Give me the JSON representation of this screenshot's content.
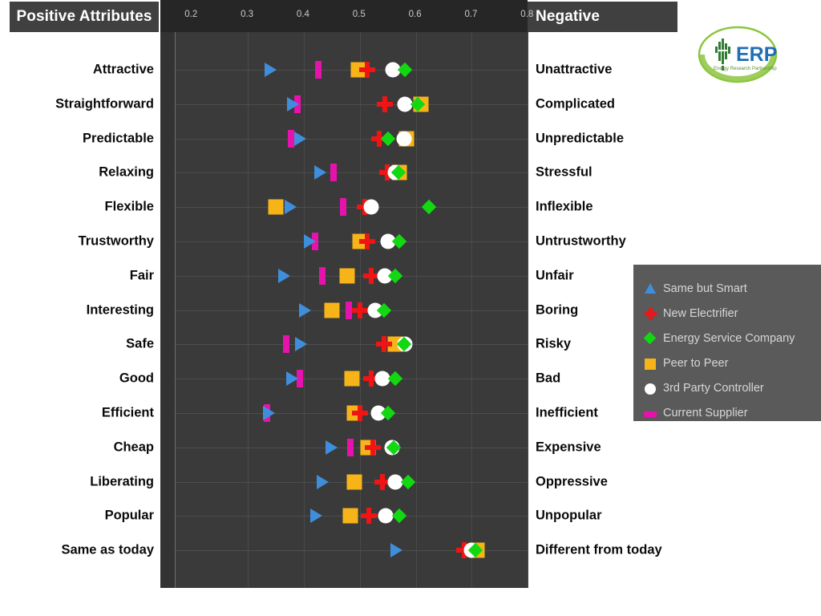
{
  "header": {
    "positive_title": "Positive Attributes",
    "negative_title": "Negative"
  },
  "logo": {
    "name": "erp-logo",
    "acronym": "ERP",
    "tagline": "Energy Research Partnership",
    "circle_color": "#8cc63f",
    "text_color": "#1f6fb5"
  },
  "legend": {
    "position": "right-middle",
    "background": "#5a5a5a",
    "items": [
      {
        "label": "Same but Smart",
        "marker": "triangle",
        "color": "#3f8edb"
      },
      {
        "label": "New Electrifier",
        "marker": "cross",
        "color": "#f01414"
      },
      {
        "label": "Energy Service Company",
        "marker": "diamond",
        "color": "#12d812"
      },
      {
        "label": "Peer to Peer",
        "marker": "square",
        "color": "#f7b419"
      },
      {
        "label": "3rd Party Controller",
        "marker": "circle",
        "color": "#ffffff"
      },
      {
        "label": "Current Supplier",
        "marker": "bar",
        "color": "#e513ac"
      }
    ]
  },
  "chart_data": {
    "type": "scatter",
    "title": "",
    "xlabel": "",
    "ylabel": "",
    "xlim": [
      0.171,
      0.801
    ],
    "ticks": [
      0.2,
      0.3,
      0.4,
      0.5,
      0.6,
      0.7,
      0.8
    ],
    "tick_labels": [
      "0.2",
      "0.3",
      "0.4",
      "0.5",
      "0.6",
      "0.7",
      "0.8"
    ],
    "grid": true,
    "legend_position": "right",
    "orientation": "horizontal",
    "categories_left": [
      "Attractive",
      "Straightforward",
      "Predictable",
      "Relaxing",
      "Flexible",
      "Trustworthy",
      "Fair",
      "Interesting",
      "Safe",
      "Good",
      "Efficient",
      "Cheap",
      "Liberating",
      "Popular",
      "Same as today"
    ],
    "categories_right": [
      "Unattractive",
      "Complicated",
      "Unpredictable",
      "Stressful",
      "Inflexible",
      "Untrustworthy",
      "Unfair",
      "Boring",
      "Risky",
      "Bad",
      "Inefficient",
      "Expensive",
      "Oppressive",
      "Unpopular",
      "Different from today"
    ],
    "series": [
      {
        "name": "Same but Smart",
        "marker": "triangle",
        "color": "#3f8edb",
        "values": [
          0.339,
          0.379,
          0.391,
          0.427,
          0.374,
          0.409,
          0.363,
          0.4,
          0.393,
          0.377,
          0.336,
          0.447,
          0.431,
          0.42,
          0.563
        ]
      },
      {
        "name": "New Electrifier",
        "marker": "cross",
        "color": "#f01414",
        "values": [
          0.513,
          0.544,
          0.534,
          0.549,
          0.509,
          0.513,
          0.52,
          0.5,
          0.543,
          0.521,
          0.5,
          0.523,
          0.541,
          0.516,
          0.686
        ]
      },
      {
        "name": "Energy Service Company",
        "marker": "diamond",
        "color": "#12d812",
        "values": [
          0.58,
          0.604,
          0.55,
          0.569,
          0.624,
          0.571,
          0.564,
          0.543,
          0.579,
          0.564,
          0.551,
          0.561,
          0.586,
          0.57,
          0.706
        ]
      },
      {
        "name": "Peer to Peer",
        "marker": "square",
        "color": "#f7b419",
        "values": [
          0.497,
          0.609,
          0.584,
          0.57,
          0.35,
          0.501,
          0.477,
          0.45,
          0.563,
          0.486,
          0.49,
          0.514,
          0.49,
          0.483,
          0.71
        ]
      },
      {
        "name": "3rd Party Controller",
        "marker": "circle",
        "color": "#ffffff",
        "values": [
          0.559,
          0.58,
          0.579,
          0.563,
          0.52,
          0.551,
          0.544,
          0.527,
          0.58,
          0.54,
          0.533,
          0.557,
          0.563,
          0.546,
          0.7
        ]
      },
      {
        "name": "Current Supplier",
        "marker": "bar",
        "color": "#e513ac",
        "values": [
          0.426,
          0.389,
          0.377,
          0.453,
          0.47,
          0.42,
          0.433,
          0.48,
          0.369,
          0.393,
          0.334,
          0.483,
          null,
          null,
          null
        ]
      }
    ]
  }
}
